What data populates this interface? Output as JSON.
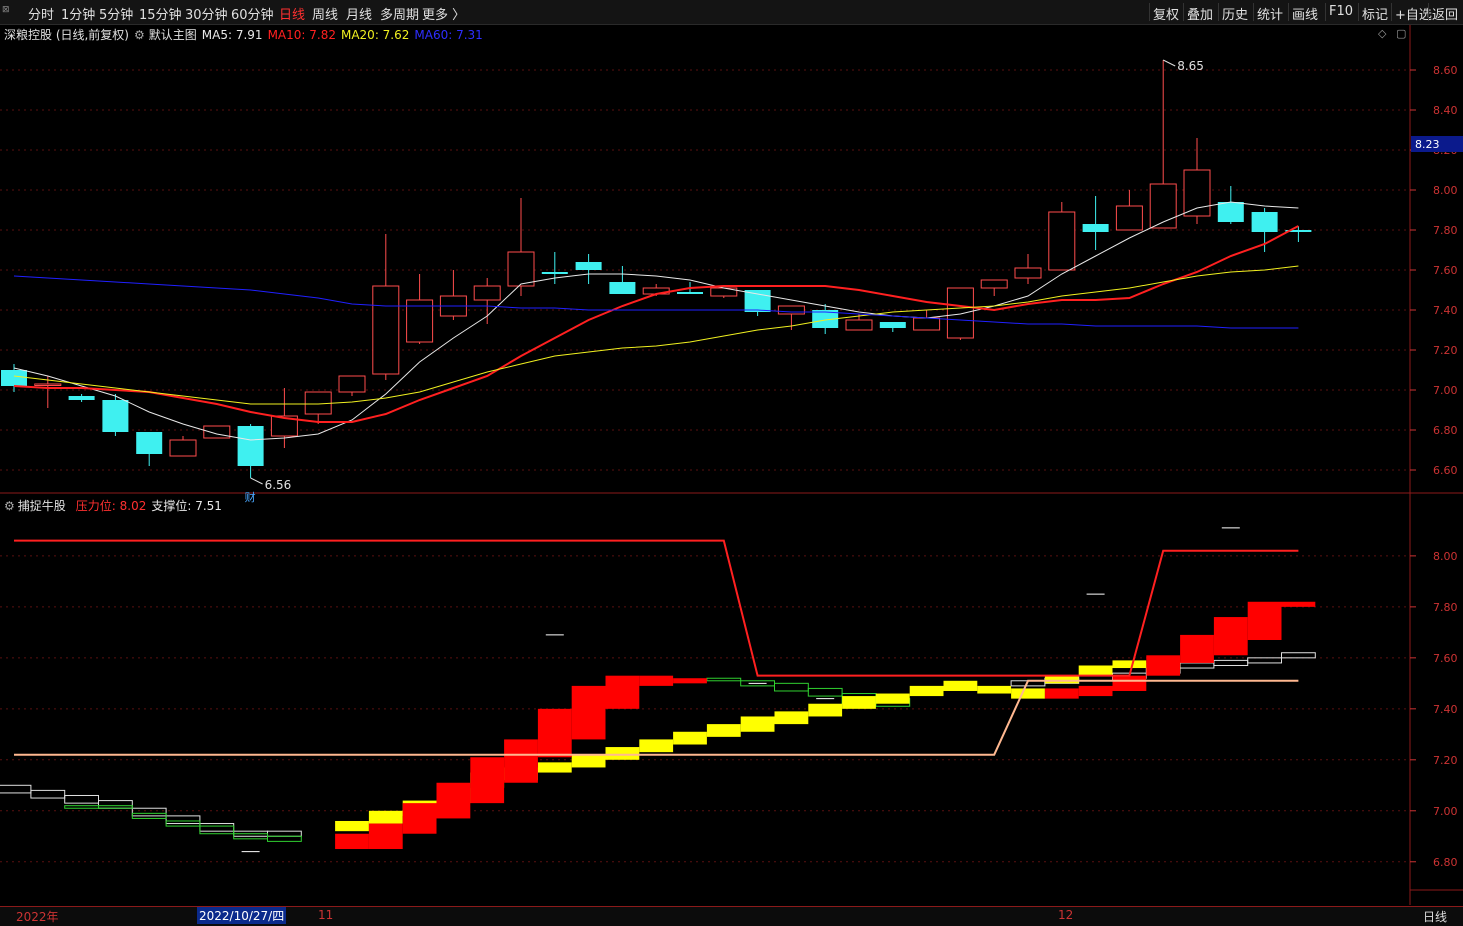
{
  "toolbar": {
    "corner_label": "设置",
    "left_tabs": [
      "分时",
      "1分钟",
      "5分钟",
      "15分钟",
      "30分钟",
      "60分钟",
      "日线",
      "周线",
      "月线",
      "多周期",
      "更多 〉"
    ],
    "active_tab": "日线",
    "right_buttons": [
      "复权",
      "叠加",
      "历史",
      "统计",
      "画线",
      "F10",
      "标记",
      "+自选",
      "返回"
    ]
  },
  "main_legend": {
    "stock": "深粮控股 (日线,前复权)",
    "indicator": "默认主图",
    "ma5": "MA5: 7.91",
    "ma10": "MA10: 7.82",
    "ma20": "MA20: 7.62",
    "ma60": "MA60: 7.31",
    "colors": {
      "ma5": "#e8e8e8",
      "ma10": "#ff2020",
      "ma20": "#f0f020",
      "ma60": "#2020ff"
    }
  },
  "sub_legend": {
    "indicator": "捕捉牛股",
    "pressure": "压力位: 8.02",
    "support": "支撑位: 7.51"
  },
  "annotations": {
    "high": "8.65",
    "low": "6.56",
    "finance_badge": "财",
    "last_price": "8.23"
  },
  "date_axis": {
    "year": "2022年",
    "selected": "2022/10/27/四",
    "m11": "11",
    "m12": "12",
    "period": "日线"
  },
  "chart_data": [
    {
      "type": "candlestick",
      "title": "深粮控股 (日线,前复权)",
      "ylim": [
        6.5,
        8.75
      ],
      "yticks": [
        6.6,
        6.8,
        7.0,
        7.2,
        7.4,
        7.6,
        7.8,
        8.0,
        8.2,
        8.4,
        8.6
      ],
      "candles": [
        {
          "o": 7.1,
          "c": 7.02,
          "h": 7.13,
          "l": 6.99
        },
        {
          "o": 7.03,
          "c": 7.03,
          "h": 7.07,
          "l": 6.91
        },
        {
          "o": 6.97,
          "c": 6.95,
          "h": 6.98,
          "l": 6.94
        },
        {
          "o": 6.95,
          "c": 6.79,
          "h": 6.98,
          "l": 6.77
        },
        {
          "o": 6.79,
          "c": 6.68,
          "h": 6.79,
          "l": 6.62
        },
        {
          "o": 6.67,
          "c": 6.75,
          "h": 6.77,
          "l": 6.67
        },
        {
          "o": 6.76,
          "c": 6.82,
          "h": 6.82,
          "l": 6.76
        },
        {
          "o": 6.82,
          "c": 6.62,
          "h": 6.83,
          "l": 6.56
        },
        {
          "o": 6.77,
          "c": 6.87,
          "h": 7.01,
          "l": 6.71
        },
        {
          "o": 6.88,
          "c": 6.99,
          "h": 6.99,
          "l": 6.83
        },
        {
          "o": 6.99,
          "c": 7.07,
          "h": 7.07,
          "l": 6.97
        },
        {
          "o": 7.08,
          "c": 7.52,
          "h": 7.78,
          "l": 7.05
        },
        {
          "o": 7.24,
          "c": 7.45,
          "h": 7.58,
          "l": 7.23
        },
        {
          "o": 7.37,
          "c": 7.47,
          "h": 7.6,
          "l": 7.35
        },
        {
          "o": 7.45,
          "c": 7.52,
          "h": 7.56,
          "l": 7.33
        },
        {
          "o": 7.52,
          "c": 7.69,
          "h": 7.96,
          "l": 7.47
        },
        {
          "o": 7.59,
          "c": 7.58,
          "h": 7.69,
          "l": 7.53
        },
        {
          "o": 7.64,
          "c": 7.6,
          "h": 7.68,
          "l": 7.53
        },
        {
          "o": 7.54,
          "c": 7.48,
          "h": 7.62,
          "l": 7.48
        },
        {
          "o": 7.48,
          "c": 7.51,
          "h": 7.53,
          "l": 7.47
        },
        {
          "o": 7.49,
          "c": 7.48,
          "h": 7.54,
          "l": 7.48
        },
        {
          "o": 7.47,
          "c": 7.51,
          "h": 7.51,
          "l": 7.46
        },
        {
          "o": 7.5,
          "c": 7.39,
          "h": 7.5,
          "l": 7.37
        },
        {
          "o": 7.38,
          "c": 7.42,
          "h": 7.42,
          "l": 7.3
        },
        {
          "o": 7.4,
          "c": 7.31,
          "h": 7.43,
          "l": 7.28
        },
        {
          "o": 7.3,
          "c": 7.35,
          "h": 7.38,
          "l": 7.3
        },
        {
          "o": 7.34,
          "c": 7.31,
          "h": 7.34,
          "l": 7.29
        },
        {
          "o": 7.3,
          "c": 7.36,
          "h": 7.4,
          "l": 7.3
        },
        {
          "o": 7.26,
          "c": 7.51,
          "h": 7.51,
          "l": 7.25
        },
        {
          "o": 7.51,
          "c": 7.55,
          "h": 7.55,
          "l": 7.47
        },
        {
          "o": 7.56,
          "c": 7.61,
          "h": 7.68,
          "l": 7.53
        },
        {
          "o": 7.6,
          "c": 7.89,
          "h": 7.94,
          "l": 7.6
        },
        {
          "o": 7.83,
          "c": 7.79,
          "h": 7.97,
          "l": 7.7
        },
        {
          "o": 7.8,
          "c": 7.92,
          "h": 8.0,
          "l": 7.8
        },
        {
          "o": 7.81,
          "c": 8.03,
          "h": 8.65,
          "l": 7.81
        },
        {
          "o": 7.87,
          "c": 8.1,
          "h": 8.26,
          "l": 7.83
        },
        {
          "o": 7.94,
          "c": 7.84,
          "h": 8.02,
          "l": 7.83
        },
        {
          "o": 7.89,
          "c": 7.79,
          "h": 7.91,
          "l": 7.69
        },
        {
          "o": 7.8,
          "c": 7.79,
          "h": 7.82,
          "l": 7.74
        }
      ],
      "series": [
        {
          "name": "MA5",
          "values": [
            7.11,
            7.07,
            7.02,
            6.97,
            6.89,
            6.83,
            6.78,
            6.75,
            6.76,
            6.78,
            6.85,
            6.98,
            7.14,
            7.26,
            7.37,
            7.53,
            7.56,
            7.58,
            7.58,
            7.57,
            7.55,
            7.51,
            7.48,
            7.45,
            7.42,
            7.39,
            7.37,
            7.36,
            7.38,
            7.42,
            7.47,
            7.58,
            7.67,
            7.76,
            7.84,
            7.91,
            7.94,
            7.92,
            7.91
          ]
        },
        {
          "name": "MA10",
          "values": [
            7.02,
            7.01,
            7.01,
            7.0,
            6.99,
            6.96,
            6.93,
            6.89,
            6.86,
            6.84,
            6.84,
            6.88,
            6.95,
            7.01,
            7.07,
            7.17,
            7.26,
            7.35,
            7.42,
            7.48,
            7.51,
            7.52,
            7.52,
            7.52,
            7.52,
            7.5,
            7.47,
            7.44,
            7.42,
            7.4,
            7.43,
            7.45,
            7.45,
            7.46,
            7.53,
            7.59,
            7.67,
            7.73,
            7.82
          ]
        },
        {
          "name": "MA20",
          "values": [
            7.07,
            7.05,
            7.03,
            7.01,
            6.99,
            6.97,
            6.95,
            6.93,
            6.93,
            6.93,
            6.94,
            6.96,
            6.99,
            7.04,
            7.09,
            7.13,
            7.17,
            7.19,
            7.21,
            7.22,
            7.24,
            7.27,
            7.3,
            7.32,
            7.35,
            7.37,
            7.39,
            7.4,
            7.41,
            7.42,
            7.44,
            7.47,
            7.49,
            7.51,
            7.54,
            7.57,
            7.59,
            7.6,
            7.62
          ]
        },
        {
          "name": "MA60",
          "values": [
            7.57,
            7.56,
            7.55,
            7.54,
            7.53,
            7.52,
            7.51,
            7.5,
            7.48,
            7.46,
            7.43,
            7.42,
            7.42,
            7.42,
            7.42,
            7.41,
            7.41,
            7.4,
            7.4,
            7.4,
            7.4,
            7.4,
            7.4,
            7.39,
            7.39,
            7.38,
            7.37,
            7.36,
            7.35,
            7.34,
            7.33,
            7.33,
            7.32,
            7.32,
            7.32,
            7.32,
            7.31,
            7.31,
            7.31
          ]
        }
      ]
    },
    {
      "type": "step",
      "title": "捕捉牛股",
      "ylim": [
        6.65,
        8.18
      ],
      "yticks": [
        6.8,
        7.0,
        7.2,
        7.4,
        7.6,
        7.8,
        8.0
      ],
      "pressure": [
        8.06,
        8.06,
        8.06,
        8.06,
        8.06,
        8.06,
        8.06,
        8.06,
        8.06,
        8.06,
        8.06,
        8.06,
        8.06,
        8.06,
        8.06,
        8.06,
        8.06,
        8.06,
        8.06,
        8.06,
        8.06,
        8.06,
        7.53,
        7.53,
        7.53,
        7.53,
        7.53,
        7.53,
        7.53,
        7.53,
        7.53,
        7.53,
        7.53,
        7.53,
        8.02,
        8.02,
        8.02,
        8.02,
        8.02
      ],
      "support": [
        7.22,
        7.22,
        7.22,
        7.22,
        7.22,
        7.22,
        7.22,
        7.22,
        7.22,
        7.22,
        7.22,
        7.22,
        7.22,
        7.22,
        7.22,
        7.22,
        7.22,
        7.22,
        7.22,
        7.22,
        7.22,
        7.22,
        7.22,
        7.22,
        7.22,
        7.22,
        7.22,
        7.22,
        7.22,
        7.22,
        7.51,
        7.51,
        7.51,
        7.51,
        7.51,
        7.51,
        7.51,
        7.51,
        7.51
      ],
      "red_upper": [
        null,
        null,
        null,
        null,
        null,
        null,
        null,
        null,
        null,
        null,
        6.91,
        6.95,
        7.03,
        7.11,
        7.21,
        7.28,
        7.4,
        7.49,
        7.53,
        7.53,
        7.52,
        null,
        null,
        null,
        null,
        null,
        null,
        null,
        null,
        null,
        null,
        7.48,
        7.49,
        7.53,
        7.61,
        7.69,
        7.76,
        7.82,
        7.82
      ],
      "red_lower": [
        null,
        null,
        null,
        null,
        null,
        null,
        null,
        null,
        null,
        null,
        6.85,
        6.85,
        6.91,
        6.97,
        7.03,
        7.11,
        7.21,
        7.28,
        7.4,
        7.49,
        7.5,
        null,
        null,
        null,
        null,
        null,
        null,
        null,
        null,
        null,
        null,
        7.44,
        7.45,
        7.47,
        7.53,
        7.58,
        7.61,
        7.67,
        7.8
      ],
      "yellow_upper": [
        null,
        null,
        null,
        null,
        null,
        null,
        null,
        null,
        null,
        null,
        6.96,
        7.0,
        7.04,
        7.09,
        7.15,
        7.17,
        7.19,
        7.22,
        7.25,
        7.28,
        7.31,
        7.34,
        7.37,
        7.39,
        7.42,
        7.45,
        7.46,
        7.49,
        7.51,
        7.49,
        7.48,
        7.53,
        7.57,
        7.59,
        7.58,
        null,
        null,
        null,
        null
      ],
      "yellow_lower": [
        null,
        null,
        null,
        null,
        null,
        null,
        null,
        null,
        null,
        null,
        6.92,
        6.95,
        6.98,
        7.03,
        7.09,
        7.12,
        7.15,
        7.17,
        7.2,
        7.23,
        7.26,
        7.29,
        7.31,
        7.34,
        7.37,
        7.4,
        7.42,
        7.45,
        7.47,
        7.46,
        7.44,
        7.5,
        7.53,
        7.56,
        7.55,
        null,
        null,
        null,
        null
      ],
      "white_upper": [
        7.1,
        7.08,
        7.06,
        7.04,
        7.01,
        6.98,
        6.95,
        6.92,
        6.92,
        null,
        null,
        null,
        null,
        null,
        null,
        null,
        null,
        null,
        null,
        null,
        null,
        null,
        null,
        null,
        null,
        null,
        null,
        null,
        null,
        null,
        7.51,
        7.52,
        7.53,
        7.54,
        7.56,
        7.58,
        7.59,
        7.6,
        7.62
      ],
      "white_lower": [
        7.07,
        7.05,
        7.03,
        7.01,
        6.98,
        6.95,
        6.92,
        6.9,
        6.9,
        null,
        null,
        null,
        null,
        null,
        null,
        null,
        null,
        null,
        null,
        null,
        null,
        null,
        null,
        null,
        null,
        null,
        null,
        null,
        null,
        null,
        7.49,
        7.5,
        7.51,
        7.52,
        7.54,
        7.56,
        7.57,
        7.58,
        7.6
      ],
      "green_upper": [
        null,
        null,
        7.02,
        7.02,
        6.99,
        6.96,
        6.94,
        6.91,
        6.9,
        null,
        null,
        null,
        null,
        null,
        null,
        null,
        null,
        null,
        null,
        null,
        null,
        7.52,
        7.51,
        7.5,
        7.48,
        7.46,
        7.44,
        null,
        null,
        null,
        null,
        null,
        null,
        null,
        null,
        null,
        null,
        null,
        null
      ],
      "green_lower": [
        null,
        null,
        7.01,
        7.01,
        6.97,
        6.94,
        6.91,
        6.89,
        6.88,
        null,
        null,
        null,
        null,
        null,
        null,
        null,
        null,
        null,
        null,
        null,
        null,
        7.51,
        7.49,
        7.47,
        7.45,
        7.42,
        7.41,
        null,
        null,
        null,
        null,
        null,
        null,
        null,
        null,
        null,
        null,
        null,
        null
      ],
      "dashes": [
        {
          "i": 7,
          "v": 6.84
        },
        {
          "i": 16,
          "v": 7.69
        },
        {
          "i": 22,
          "v": 7.5
        },
        {
          "i": 24,
          "v": 7.44
        },
        {
          "i": 32,
          "v": 7.85
        },
        {
          "i": 36,
          "v": 8.11
        }
      ]
    }
  ]
}
